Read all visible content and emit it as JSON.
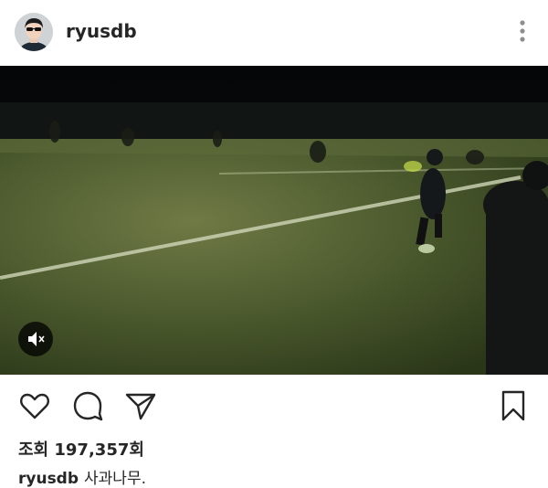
{
  "header": {
    "username": "ryusdb",
    "avatar_icon": "profile-avatar",
    "more_icon": "vertical-ellipsis-icon"
  },
  "media": {
    "type": "video",
    "description_icon": "video-player",
    "mute_icon": "speaker-muted-icon"
  },
  "actions": {
    "like_icon": "heart-icon",
    "comment_icon": "comment-bubble-icon",
    "share_icon": "paper-plane-icon",
    "save_icon": "bookmark-icon"
  },
  "stats": {
    "views_label": "조회 197,357회"
  },
  "caption": {
    "username": "ryusdb",
    "text": "사과나무."
  },
  "colors": {
    "text": "#262626",
    "background": "#ffffff",
    "media_bg": "#000000"
  }
}
